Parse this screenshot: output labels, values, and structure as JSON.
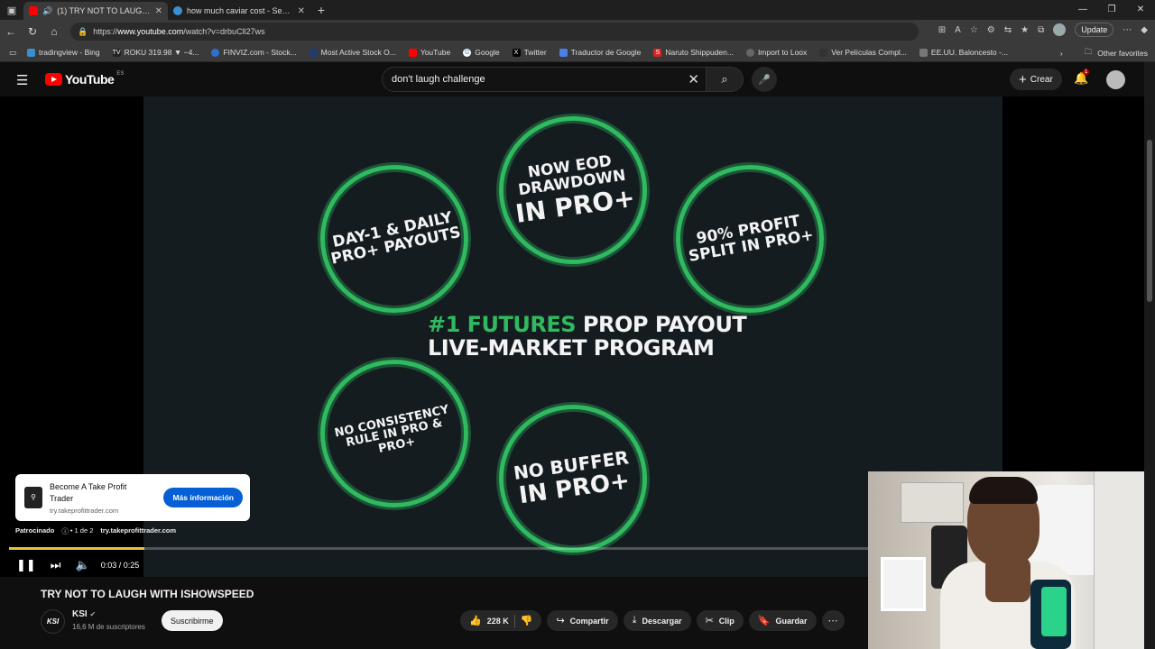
{
  "browser": {
    "tabs": [
      {
        "title": "(1) TRY NOT TO LAUGH WITH ISHOWSPEED",
        "favicon_color": "#ff0000",
        "active": true
      },
      {
        "title": "how much caviar cost - Search",
        "favicon_color": "#3b8ed0",
        "active": false
      }
    ],
    "url_prefix": "https://",
    "url_domain": "www.youtube.com",
    "url_path": "/watch?v=drbuCll27ws",
    "update_label": "Update",
    "bookmarks": [
      {
        "label": "tradingview - Bing",
        "icon_color": "#3b8ed0"
      },
      {
        "label": "ROKU 319.98 ▼ −4...",
        "icon_color": "#222",
        "icon_text": "TV"
      },
      {
        "label": "FINVIZ.com - Stock...",
        "icon_color": "#2f6fd1"
      },
      {
        "label": "Most Active Stock O...",
        "icon_color": "#223a70"
      },
      {
        "label": "YouTube",
        "icon_color": "#ff0000"
      },
      {
        "label": "Google",
        "icon_color": "#ffffff"
      },
      {
        "label": "Twitter",
        "icon_color": "#000000",
        "icon_text": "X"
      },
      {
        "label": "Traductor de Google",
        "icon_color": "#4a80e8"
      },
      {
        "label": "Naruto Shippuden...",
        "icon_color": "#d22",
        "icon_text": "S"
      },
      {
        "label": "Import to Loox",
        "icon_color": "#666"
      },
      {
        "label": "Ver Películas Compl...",
        "icon_color": "#333"
      },
      {
        "label": "EE.UU. Baloncesto -...",
        "icon_color": "#777"
      }
    ],
    "other_favorites": "Other favorites"
  },
  "youtube": {
    "logo_text": "YouTube",
    "region": "ES",
    "search_query": "don't laugh challenge",
    "create_label": "Crear",
    "notification_count": "1"
  },
  "video": {
    "stamps": [
      {
        "lines": [
          "DAY-1 & DAILY",
          "PRO+ PAYOUTS"
        ]
      },
      {
        "lines": [
          "NOW EOD",
          "DRAWDOWN",
          "IN PRO+"
        ]
      },
      {
        "lines": [
          "90% PROFIT",
          "SPLIT IN PRO+"
        ]
      },
      {
        "lines": [
          "NO CONSISTENCY",
          "RULE IN PRO & PRO+"
        ]
      },
      {
        "lines": [
          "NO BUFFER",
          "IN PRO+"
        ]
      }
    ],
    "headline_green": "#1 FUTURES",
    "headline_white": " PROP PAYOUT",
    "headline_line2": "LIVE-MARKET PROGRAM",
    "time": "0:03 / 0:25",
    "progress": 0.12,
    "accent": "#2fba60"
  },
  "ad": {
    "title": "Become A Take Profit Trader",
    "url": "try.takeprofittrader.com",
    "cta": "Más información",
    "sponsored": "Patrocinado",
    "count": "• 1 de 2",
    "meta_url": "try.takeprofittrader.com"
  },
  "watch": {
    "title": "TRY NOT TO LAUGH WITH ISHOWSPEED",
    "channel": "KSI",
    "channel_avatar_text": "KSI",
    "subscribers": "16,6 M de suscriptores",
    "subscribe": "Suscribirme",
    "likes": "228 K",
    "share": "Compartir",
    "download": "Descargar",
    "clip": "Clip",
    "save": "Guardar"
  }
}
